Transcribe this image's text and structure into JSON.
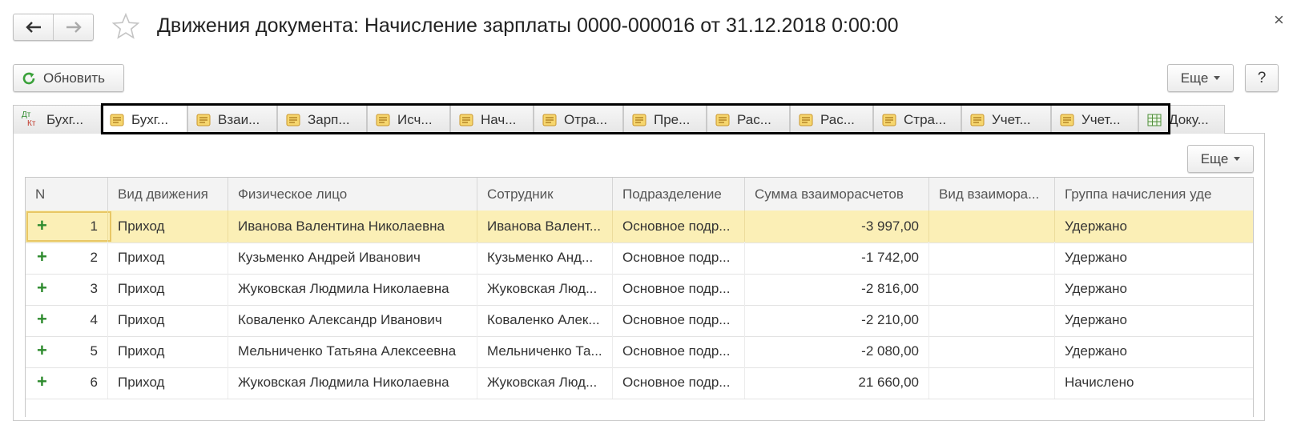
{
  "window": {
    "title": "Движения документа: Начисление зарплаты 0000-000016 от 31.12.2018 0:00:00",
    "close_glyph": "×"
  },
  "toolbar": {
    "refresh_label": "Обновить",
    "more_label": "Еще",
    "help_label": "?"
  },
  "tabs": [
    {
      "label": "Бухг...",
      "icon": "dt-kt-icon"
    },
    {
      "label": "Бухг...",
      "icon": "register-icon"
    },
    {
      "label": "Взаи...",
      "icon": "register-icon"
    },
    {
      "label": "Зарп...",
      "icon": "register-icon"
    },
    {
      "label": "Исч...",
      "icon": "register-icon"
    },
    {
      "label": "Нач...",
      "icon": "register-icon"
    },
    {
      "label": "Отра...",
      "icon": "register-icon"
    },
    {
      "label": "Пре...",
      "icon": "register-icon"
    },
    {
      "label": "Рас...",
      "icon": "register-icon"
    },
    {
      "label": "Рас...",
      "icon": "register-icon"
    },
    {
      "label": "Стра...",
      "icon": "register-icon"
    },
    {
      "label": "Учет...",
      "icon": "register-icon"
    },
    {
      "label": "Учет...",
      "icon": "register-icon"
    },
    {
      "label": "Доку...",
      "icon": "table-icon"
    }
  ],
  "tab_icon_text": {
    "dt": "Дт",
    "kt": "Кт"
  },
  "table": {
    "more_label": "Еще",
    "columns": [
      "N",
      "Вид движения",
      "Физическое лицо",
      "Сотрудник",
      "Подразделение",
      "Сумма взаиморасчетов",
      "Вид взаимора...",
      "Группа начисления уде"
    ],
    "rows": [
      {
        "n": "1",
        "movement": "Приход",
        "person": "Иванова Валентина Николаевна",
        "employee": "Иванова Валент...",
        "department": "Основное подр...",
        "amount": "-3 997,00",
        "settlement_type": "",
        "group": "Удержано"
      },
      {
        "n": "2",
        "movement": "Приход",
        "person": "Кузьменко Андрей Иванович",
        "employee": "Кузьменко Анд...",
        "department": "Основное подр...",
        "amount": "-1 742,00",
        "settlement_type": "",
        "group": "Удержано"
      },
      {
        "n": "3",
        "movement": "Приход",
        "person": "Жуковская Людмила Николаевна",
        "employee": "Жуковская Люд...",
        "department": "Основное подр...",
        "amount": "-2 816,00",
        "settlement_type": "",
        "group": "Удержано"
      },
      {
        "n": "4",
        "movement": "Приход",
        "person": "Коваленко Александр Иванович",
        "employee": "Коваленко Алек...",
        "department": "Основное подр...",
        "amount": "-2 210,00",
        "settlement_type": "",
        "group": "Удержано"
      },
      {
        "n": "5",
        "movement": "Приход",
        "person": "Мельниченко Татьяна Алексеевна",
        "employee": "Мельниченко Та...",
        "department": "Основное подр...",
        "amount": "-2 080,00",
        "settlement_type": "",
        "group": "Удержано"
      },
      {
        "n": "6",
        "movement": "Приход",
        "person": "Жуковская Людмила Николаевна",
        "employee": "Жуковская Люд...",
        "department": "Основное подр...",
        "amount": "21 660,00",
        "settlement_type": "",
        "group": "Начислено"
      }
    ],
    "plus_glyph": "+"
  },
  "colors": {
    "selected_row": "#fbefb6",
    "plus_green": "#2e8b2e",
    "refresh_green": "#3aa13a",
    "register_icon": "#e8b83a"
  }
}
